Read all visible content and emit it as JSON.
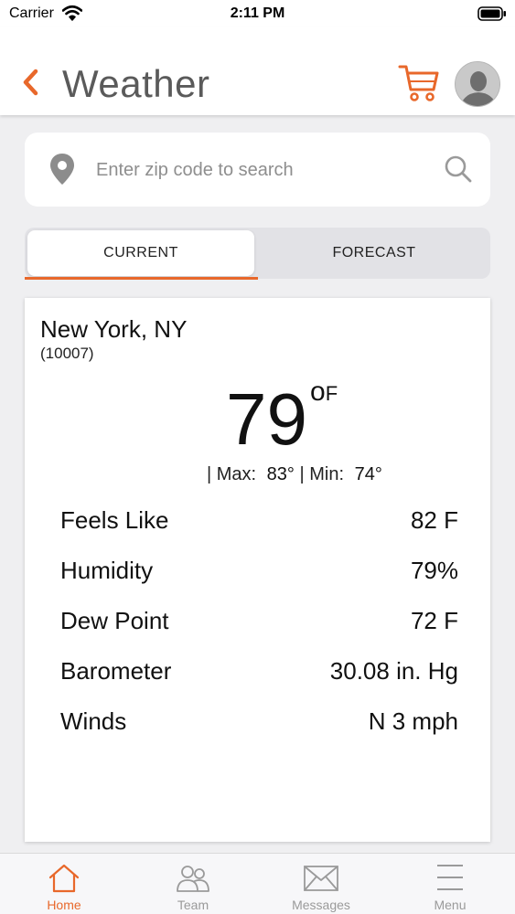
{
  "status_bar": {
    "carrier": "Carrier",
    "time": "2:11 PM"
  },
  "header": {
    "title": "Weather",
    "back_icon": "chevron-left-icon",
    "cart_icon": "shopping-cart-icon",
    "avatar_icon": "user-avatar"
  },
  "search": {
    "placeholder": "Enter zip code to search",
    "value": "",
    "left_icon": "location-pin-icon",
    "right_icon": "search-icon"
  },
  "tabs": [
    {
      "label": "CURRENT",
      "active": true
    },
    {
      "label": "FORECAST",
      "active": false
    }
  ],
  "weather": {
    "city": "New York, NY",
    "zip": "(10007)",
    "temperature": "79",
    "unit_degree": "o",
    "unit_letter": "F",
    "max_label": "| Max:",
    "max_value": "83°",
    "min_label": "| Min:",
    "min_value": "74°",
    "details": [
      {
        "label": "Feels Like",
        "value": "82 F"
      },
      {
        "label": "Humidity",
        "value": "79%"
      },
      {
        "label": "Dew Point",
        "value": "72 F"
      },
      {
        "label": "Barometer",
        "value": "30.08 in. Hg"
      },
      {
        "label": "Winds",
        "value": "N 3 mph"
      }
    ]
  },
  "tabbar": [
    {
      "label": "Home",
      "icon": "home-icon",
      "active": true
    },
    {
      "label": "Team",
      "icon": "team-icon",
      "active": false
    },
    {
      "label": "Messages",
      "icon": "envelope-icon",
      "active": false
    },
    {
      "label": "Menu",
      "icon": "hamburger-menu-icon",
      "active": false
    }
  ],
  "colors": {
    "accent": "#e8682b",
    "background": "#efeff1",
    "inactive_tab_label": "#9a9a9a"
  }
}
